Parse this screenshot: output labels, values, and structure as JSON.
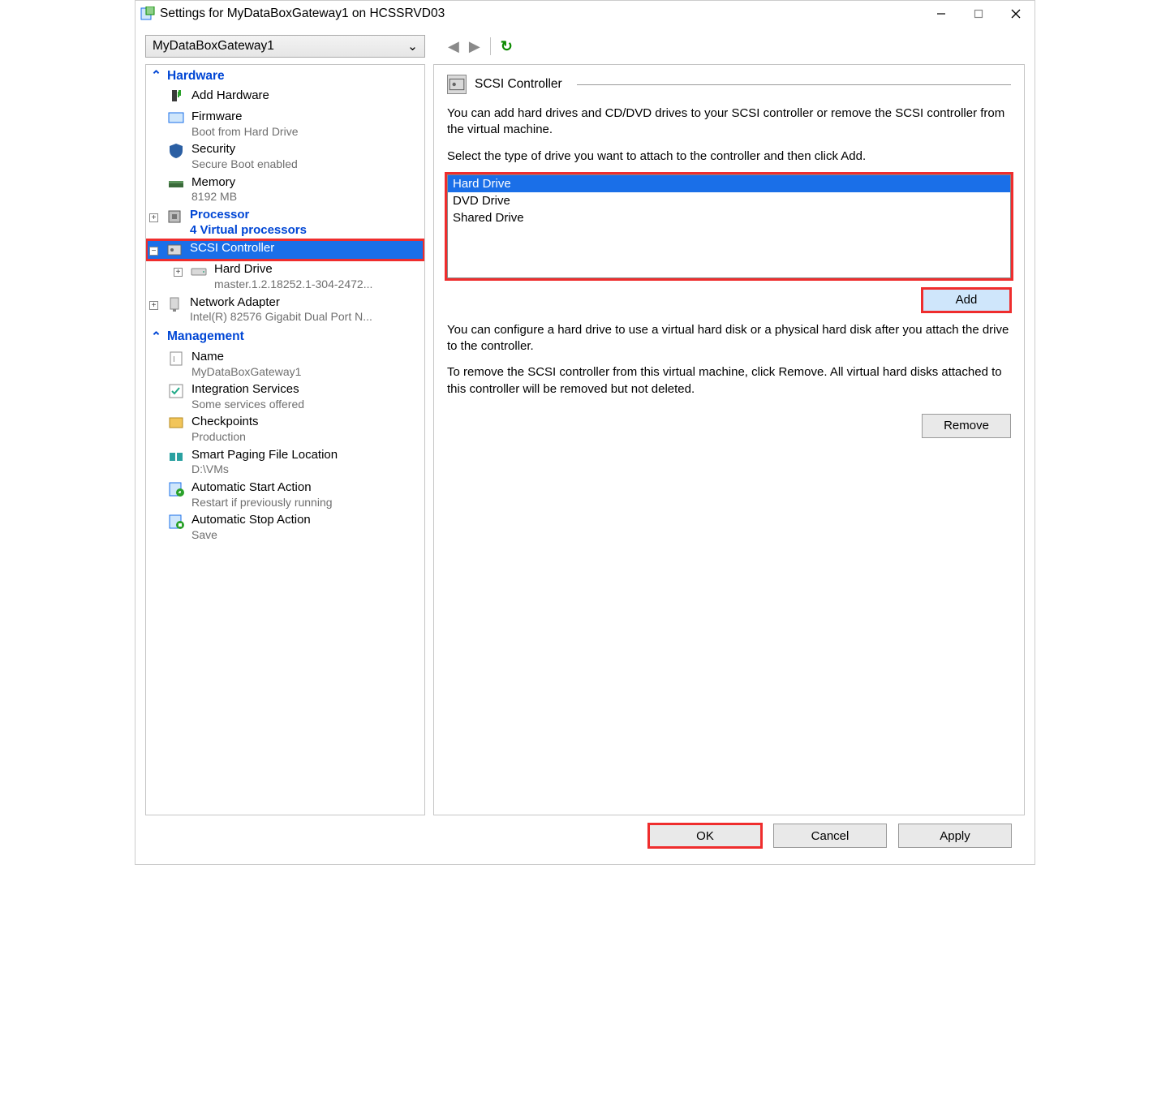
{
  "window": {
    "title": "Settings for MyDataBoxGateway1 on HCSSRVD03"
  },
  "toolbar": {
    "vm_name": "MyDataBoxGateway1"
  },
  "sidebar": {
    "hardware_section": "Hardware",
    "management_section": "Management",
    "items": {
      "add_hardware": {
        "label": "Add Hardware"
      },
      "firmware": {
        "label": "Firmware",
        "sub": "Boot from Hard Drive"
      },
      "security": {
        "label": "Security",
        "sub": "Secure Boot enabled"
      },
      "memory": {
        "label": "Memory",
        "sub": "8192 MB"
      },
      "processor": {
        "label": "Processor",
        "sub": "4 Virtual processors"
      },
      "scsi": {
        "label": "SCSI Controller"
      },
      "hd": {
        "label": "Hard Drive",
        "sub": "master.1.2.18252.1-304-2472..."
      },
      "nic": {
        "label": "Network Adapter",
        "sub": "Intel(R) 82576 Gigabit Dual Port N..."
      },
      "name": {
        "label": "Name",
        "sub": "MyDataBoxGateway1"
      },
      "integration": {
        "label": "Integration Services",
        "sub": "Some services offered"
      },
      "checkpoints": {
        "label": "Checkpoints",
        "sub": "Production"
      },
      "paging": {
        "label": "Smart Paging File Location",
        "sub": "D:\\VMs"
      },
      "autostart": {
        "label": "Automatic Start Action",
        "sub": "Restart if previously running"
      },
      "autostop": {
        "label": "Automatic Stop Action",
        "sub": "Save"
      }
    }
  },
  "panel": {
    "title": "SCSI Controller",
    "intro": "You can add hard drives and CD/DVD drives to your SCSI controller or remove the SCSI controller from the virtual machine.",
    "select_prompt": "Select the type of drive you want to attach to the controller and then click Add.",
    "drives": [
      "Hard Drive",
      "DVD Drive",
      "Shared Drive"
    ],
    "add": "Add",
    "configure": "You can configure a hard drive to use a virtual hard disk or a physical hard disk after you attach the drive to the controller.",
    "remove_info": "To remove the SCSI controller from this virtual machine, click Remove. All virtual hard disks attached to this controller will be removed but not deleted.",
    "remove": "Remove"
  },
  "footer": {
    "ok": "OK",
    "cancel": "Cancel",
    "apply": "Apply"
  }
}
